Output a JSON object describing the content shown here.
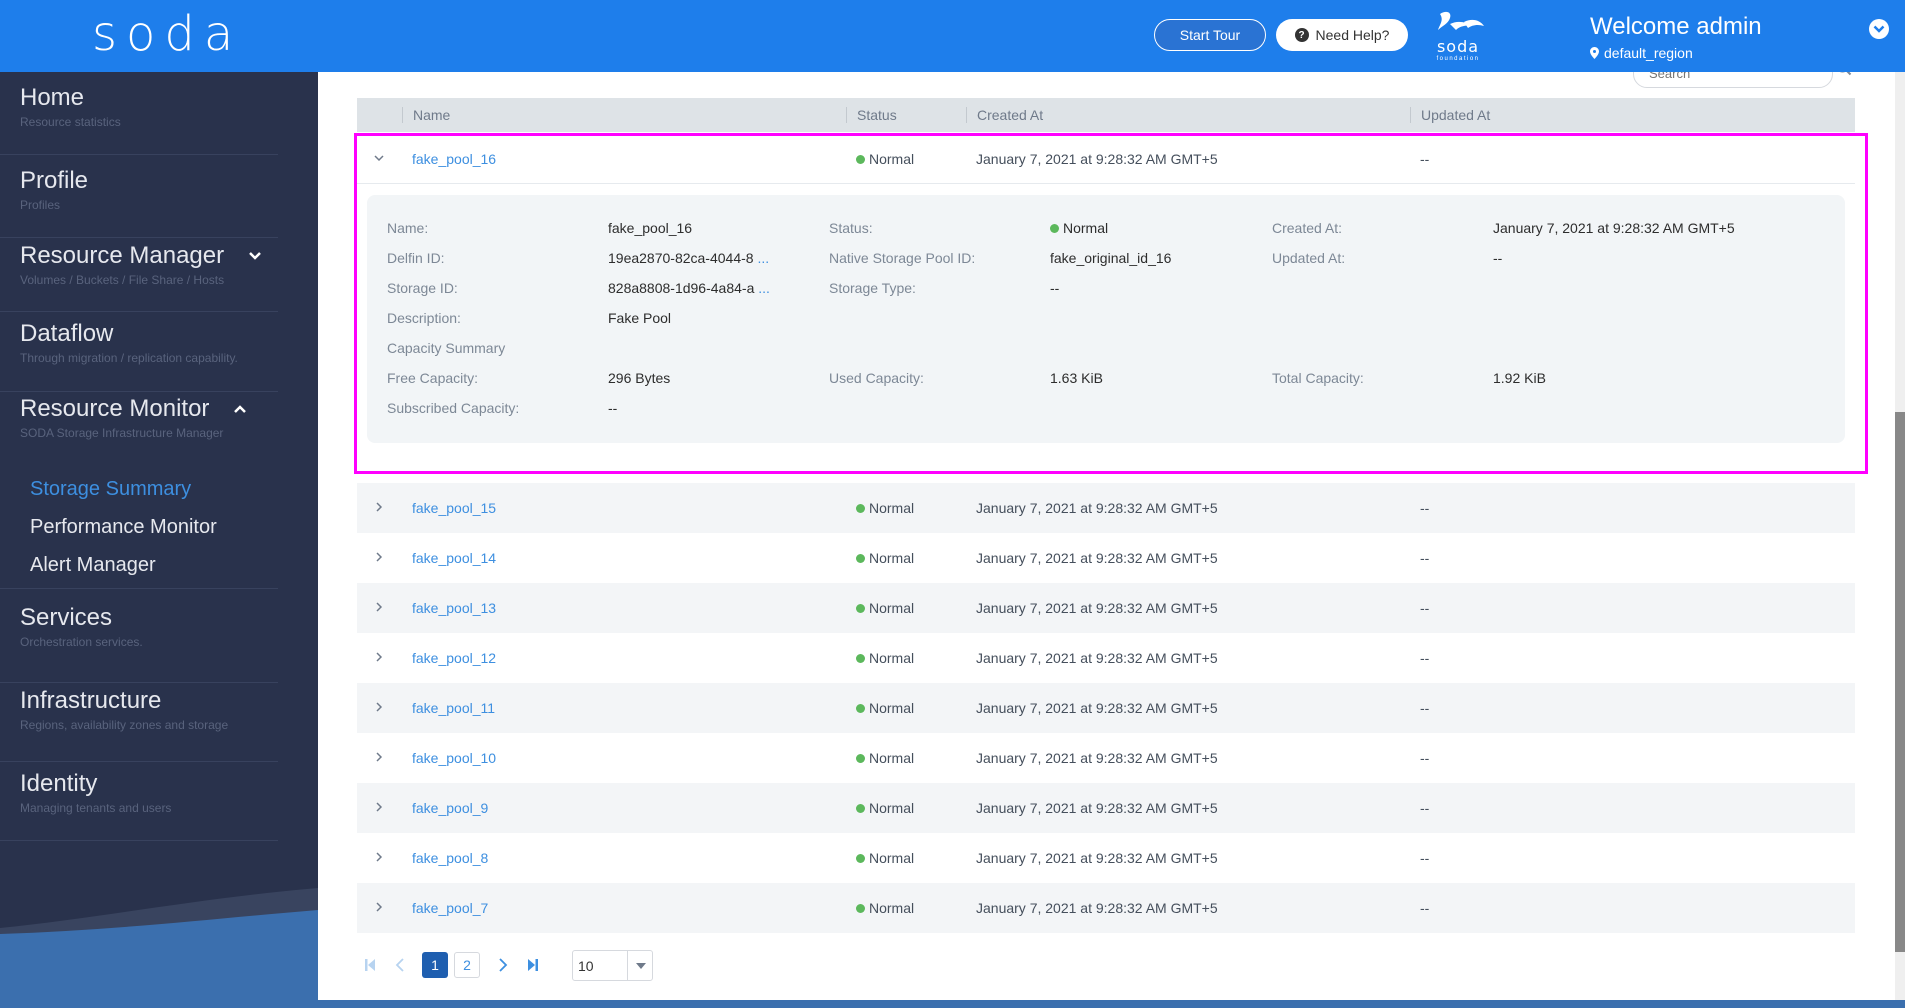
{
  "header": {
    "logo": "soda",
    "start_tour": "Start Tour",
    "need_help": "Need Help?",
    "foundation_logo_word": "soda",
    "foundation_logo_sub": "foundation",
    "welcome": "Welcome admin",
    "region": "default_region"
  },
  "sidebar": {
    "items": [
      {
        "title": "Home",
        "sub": "Resource statistics"
      },
      {
        "title": "Profile",
        "sub": "Profiles"
      },
      {
        "title": "Resource Manager",
        "sub": "Volumes / Buckets / File Share / Hosts",
        "expanded": false
      },
      {
        "title": "Dataflow",
        "sub": "Through migration / replication capability."
      },
      {
        "title": "Resource Monitor",
        "sub": "SODA Storage Infrastructure Manager",
        "expanded": true
      },
      {
        "title": "Services",
        "sub": "Orchestration services."
      },
      {
        "title": "Infrastructure",
        "sub": "Regions, availability zones and storage"
      },
      {
        "title": "Identity",
        "sub": "Managing tenants and users"
      }
    ],
    "resource_monitor_children": [
      {
        "label": "Storage Summary",
        "active": true
      },
      {
        "label": "Performance Monitor",
        "active": false
      },
      {
        "label": "Alert Manager",
        "active": false
      }
    ]
  },
  "search": {
    "placeholder": "Search"
  },
  "table": {
    "columns": [
      "Name",
      "Status",
      "Created At",
      "Updated At"
    ],
    "expanded_row": {
      "name": "fake_pool_16",
      "status": "Normal",
      "created": "January 7, 2021 at 9:28:32 AM GMT+5",
      "updated": "--"
    },
    "detail": {
      "name_label": "Name:",
      "name_value": "fake_pool_16",
      "delfin_label": "Delfin ID:",
      "delfin_value": "19ea2870-82ca-4044-8",
      "delfin_ellipsis": "...",
      "storage_id_label": "Storage ID:",
      "storage_id_value": "828a8808-1d96-4a84-a",
      "storage_id_ellipsis": "...",
      "description_label": "Description:",
      "description_value": "Fake Pool",
      "capacity_summary_label": "Capacity Summary",
      "free_label": "Free Capacity:",
      "free_value": "296 Bytes",
      "subscribed_label": "Subscribed Capacity:",
      "subscribed_value": "--",
      "status_label": "Status:",
      "status_value": "Normal",
      "native_label": "Native Storage Pool ID:",
      "native_value": "fake_original_id_16",
      "storage_type_label": "Storage Type:",
      "storage_type_value": "--",
      "used_label": "Used Capacity:",
      "used_value": "1.63 KiB",
      "created_label": "Created At:",
      "created_value": "January 7, 2021 at 9:28:32 AM GMT+5",
      "updated_label": "Updated At:",
      "updated_value": "--",
      "total_label": "Total Capacity:",
      "total_value": "1.92 KiB"
    },
    "rows": [
      {
        "name": "fake_pool_15",
        "status": "Normal",
        "created": "January 7, 2021 at 9:28:32 AM GMT+5",
        "updated": "--"
      },
      {
        "name": "fake_pool_14",
        "status": "Normal",
        "created": "January 7, 2021 at 9:28:32 AM GMT+5",
        "updated": "--"
      },
      {
        "name": "fake_pool_13",
        "status": "Normal",
        "created": "January 7, 2021 at 9:28:32 AM GMT+5",
        "updated": "--"
      },
      {
        "name": "fake_pool_12",
        "status": "Normal",
        "created": "January 7, 2021 at 9:28:32 AM GMT+5",
        "updated": "--"
      },
      {
        "name": "fake_pool_11",
        "status": "Normal",
        "created": "January 7, 2021 at 9:28:32 AM GMT+5",
        "updated": "--"
      },
      {
        "name": "fake_pool_10",
        "status": "Normal",
        "created": "January 7, 2021 at 9:28:32 AM GMT+5",
        "updated": "--"
      },
      {
        "name": "fake_pool_9",
        "status": "Normal",
        "created": "January 7, 2021 at 9:28:32 AM GMT+5",
        "updated": "--"
      },
      {
        "name": "fake_pool_8",
        "status": "Normal",
        "created": "January 7, 2021 at 9:28:32 AM GMT+5",
        "updated": "--"
      },
      {
        "name": "fake_pool_7",
        "status": "Normal",
        "created": "January 7, 2021 at 9:28:32 AM GMT+5",
        "updated": "--"
      }
    ]
  },
  "pagination": {
    "pages": [
      "1",
      "2"
    ],
    "current": "1",
    "page_size": "10"
  },
  "colors": {
    "header_bg": "#1e7eeb",
    "sidebar_bg": "#29324c",
    "accent": "#3d8fe0",
    "status_normal": "#5cb85c",
    "highlight": "#ff00ff"
  }
}
